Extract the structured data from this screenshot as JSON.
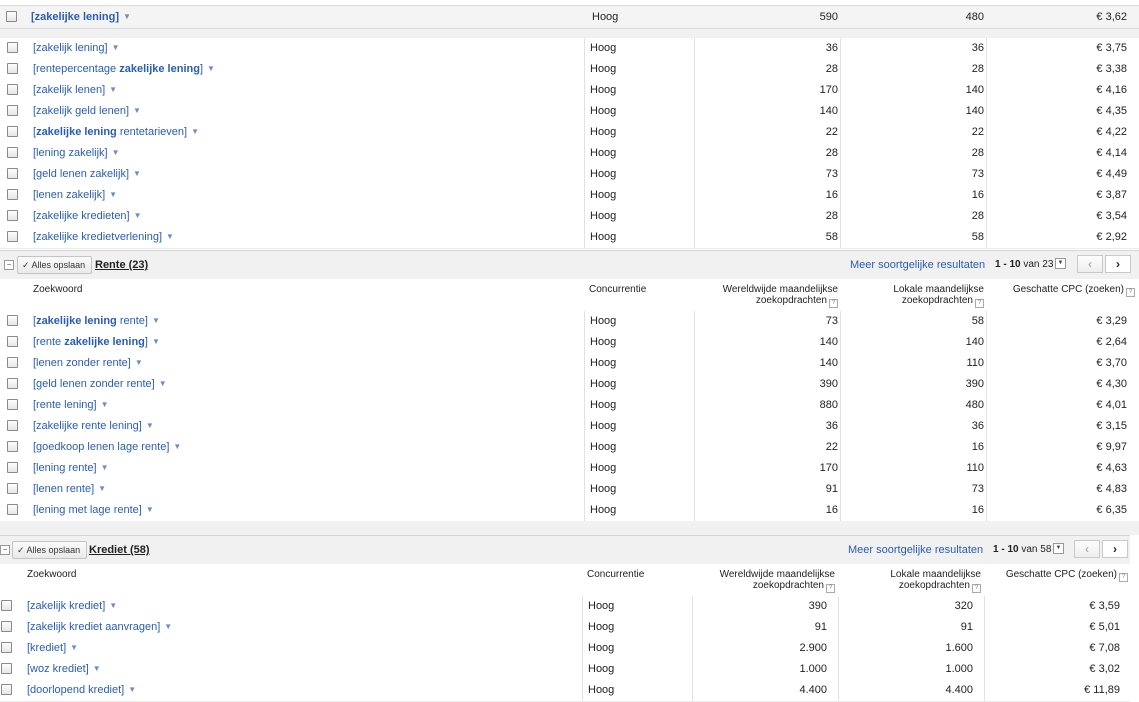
{
  "top_row": {
    "keyword": "[zakelijke lening]",
    "bold": "zakelijke lening",
    "competition": "Hoog",
    "global": "590",
    "local": "480",
    "cpc": "€ 3,62"
  },
  "groups": [
    {
      "rows": [
        {
          "pre": "[zakelijk lening]",
          "bold": "",
          "post": "",
          "competition": "Hoog",
          "global": "36",
          "local": "36",
          "cpc": "€ 3,75"
        },
        {
          "pre": "[rentepercentage ",
          "bold": "zakelijke lening",
          "post": "]",
          "competition": "Hoog",
          "global": "28",
          "local": "28",
          "cpc": "€ 3,38"
        },
        {
          "pre": "[zakelijk lenen]",
          "bold": "",
          "post": "",
          "competition": "Hoog",
          "global": "170",
          "local": "140",
          "cpc": "€ 4,16"
        },
        {
          "pre": "[zakelijk geld lenen]",
          "bold": "",
          "post": "",
          "competition": "Hoog",
          "global": "140",
          "local": "140",
          "cpc": "€ 4,35"
        },
        {
          "pre": "[",
          "bold": "zakelijke lening",
          "post": " rentetarieven]",
          "competition": "Hoog",
          "global": "22",
          "local": "22",
          "cpc": "€ 4,22"
        },
        {
          "pre": "[lening zakelijk]",
          "bold": "",
          "post": "",
          "competition": "Hoog",
          "global": "28",
          "local": "28",
          "cpc": "€ 4,14"
        },
        {
          "pre": "[geld lenen zakelijk]",
          "bold": "",
          "post": "",
          "competition": "Hoog",
          "global": "73",
          "local": "73",
          "cpc": "€ 4,49"
        },
        {
          "pre": "[lenen zakelijk]",
          "bold": "",
          "post": "",
          "competition": "Hoog",
          "global": "16",
          "local": "16",
          "cpc": "€ 3,87"
        },
        {
          "pre": "[zakelijke kredieten]",
          "bold": "",
          "post": "",
          "competition": "Hoog",
          "global": "28",
          "local": "28",
          "cpc": "€ 3,54"
        },
        {
          "pre": "[zakelijke kredietverlening]",
          "bold": "",
          "post": "",
          "competition": "Hoog",
          "global": "58",
          "local": "58",
          "cpc": "€ 2,92"
        }
      ]
    },
    {
      "save_label": "✓ Alles opslaan",
      "title": "Rente (23)",
      "more_link": "Meer soortgelijke resultaten",
      "pager_range": "1 - 10",
      "pager_of": "van 23",
      "rows": [
        {
          "pre": "[",
          "bold": "zakelijke lening",
          "post": " rente]",
          "competition": "Hoog",
          "global": "73",
          "local": "58",
          "cpc": "€ 3,29"
        },
        {
          "pre": "[rente ",
          "bold": "zakelijke lening",
          "post": "]",
          "competition": "Hoog",
          "global": "140",
          "local": "140",
          "cpc": "€ 2,64"
        },
        {
          "pre": "[lenen zonder rente]",
          "bold": "",
          "post": "",
          "competition": "Hoog",
          "global": "140",
          "local": "110",
          "cpc": "€ 3,70"
        },
        {
          "pre": "[geld lenen zonder rente]",
          "bold": "",
          "post": "",
          "competition": "Hoog",
          "global": "390",
          "local": "390",
          "cpc": "€ 4,30"
        },
        {
          "pre": "[rente lening]",
          "bold": "",
          "post": "",
          "competition": "Hoog",
          "global": "880",
          "local": "480",
          "cpc": "€ 4,01"
        },
        {
          "pre": "[zakelijke rente lening]",
          "bold": "",
          "post": "",
          "competition": "Hoog",
          "global": "36",
          "local": "36",
          "cpc": "€ 3,15"
        },
        {
          "pre": "[goedkoop lenen lage rente]",
          "bold": "",
          "post": "",
          "competition": "Hoog",
          "global": "22",
          "local": "16",
          "cpc": "€ 9,97"
        },
        {
          "pre": "[lening rente]",
          "bold": "",
          "post": "",
          "competition": "Hoog",
          "global": "170",
          "local": "110",
          "cpc": "€ 4,63"
        },
        {
          "pre": "[lenen rente]",
          "bold": "",
          "post": "",
          "competition": "Hoog",
          "global": "91",
          "local": "73",
          "cpc": "€ 4,83"
        },
        {
          "pre": "[lening met lage rente]",
          "bold": "",
          "post": "",
          "competition": "Hoog",
          "global": "16",
          "local": "16",
          "cpc": "€ 6,35"
        }
      ]
    },
    {
      "save_label": "✓ Alles opslaan",
      "title": "Krediet (58)",
      "more_link": "Meer soortgelijke resultaten",
      "pager_range": "1 - 10",
      "pager_of": "van 58",
      "rows": [
        {
          "pre": "[zakelijk krediet]",
          "bold": "",
          "post": "",
          "competition": "Hoog",
          "global": "390",
          "local": "320",
          "cpc": "€ 3,59"
        },
        {
          "pre": "[zakelijk krediet aanvragen]",
          "bold": "",
          "post": "",
          "competition": "Hoog",
          "global": "91",
          "local": "91",
          "cpc": "€ 5,01"
        },
        {
          "pre": "[krediet]",
          "bold": "",
          "post": "",
          "competition": "Hoog",
          "global": "2.900",
          "local": "1.600",
          "cpc": "€ 7,08"
        },
        {
          "pre": "[woz krediet]",
          "bold": "",
          "post": "",
          "competition": "Hoog",
          "global": "1.000",
          "local": "1.000",
          "cpc": "€ 3,02"
        },
        {
          "pre": "[doorlopend krediet]",
          "bold": "",
          "post": "",
          "competition": "Hoog",
          "global": "4.400",
          "local": "4.400",
          "cpc": "€ 11,89"
        }
      ]
    }
  ],
  "columns": {
    "keyword": "Zoekwoord",
    "competition": "Concurrentie",
    "global_l1": "Wereldwijde maandelijkse",
    "global_l2": "zoekopdrachten",
    "local_l1": "Lokale maandelijkse",
    "local_l2": "zoekopdrachten",
    "cpc": "Geschatte CPC (zoeken)",
    "help": "?"
  },
  "icons": {
    "dropdown": "▼",
    "prev": "‹",
    "next": "›",
    "collapse": "−"
  }
}
